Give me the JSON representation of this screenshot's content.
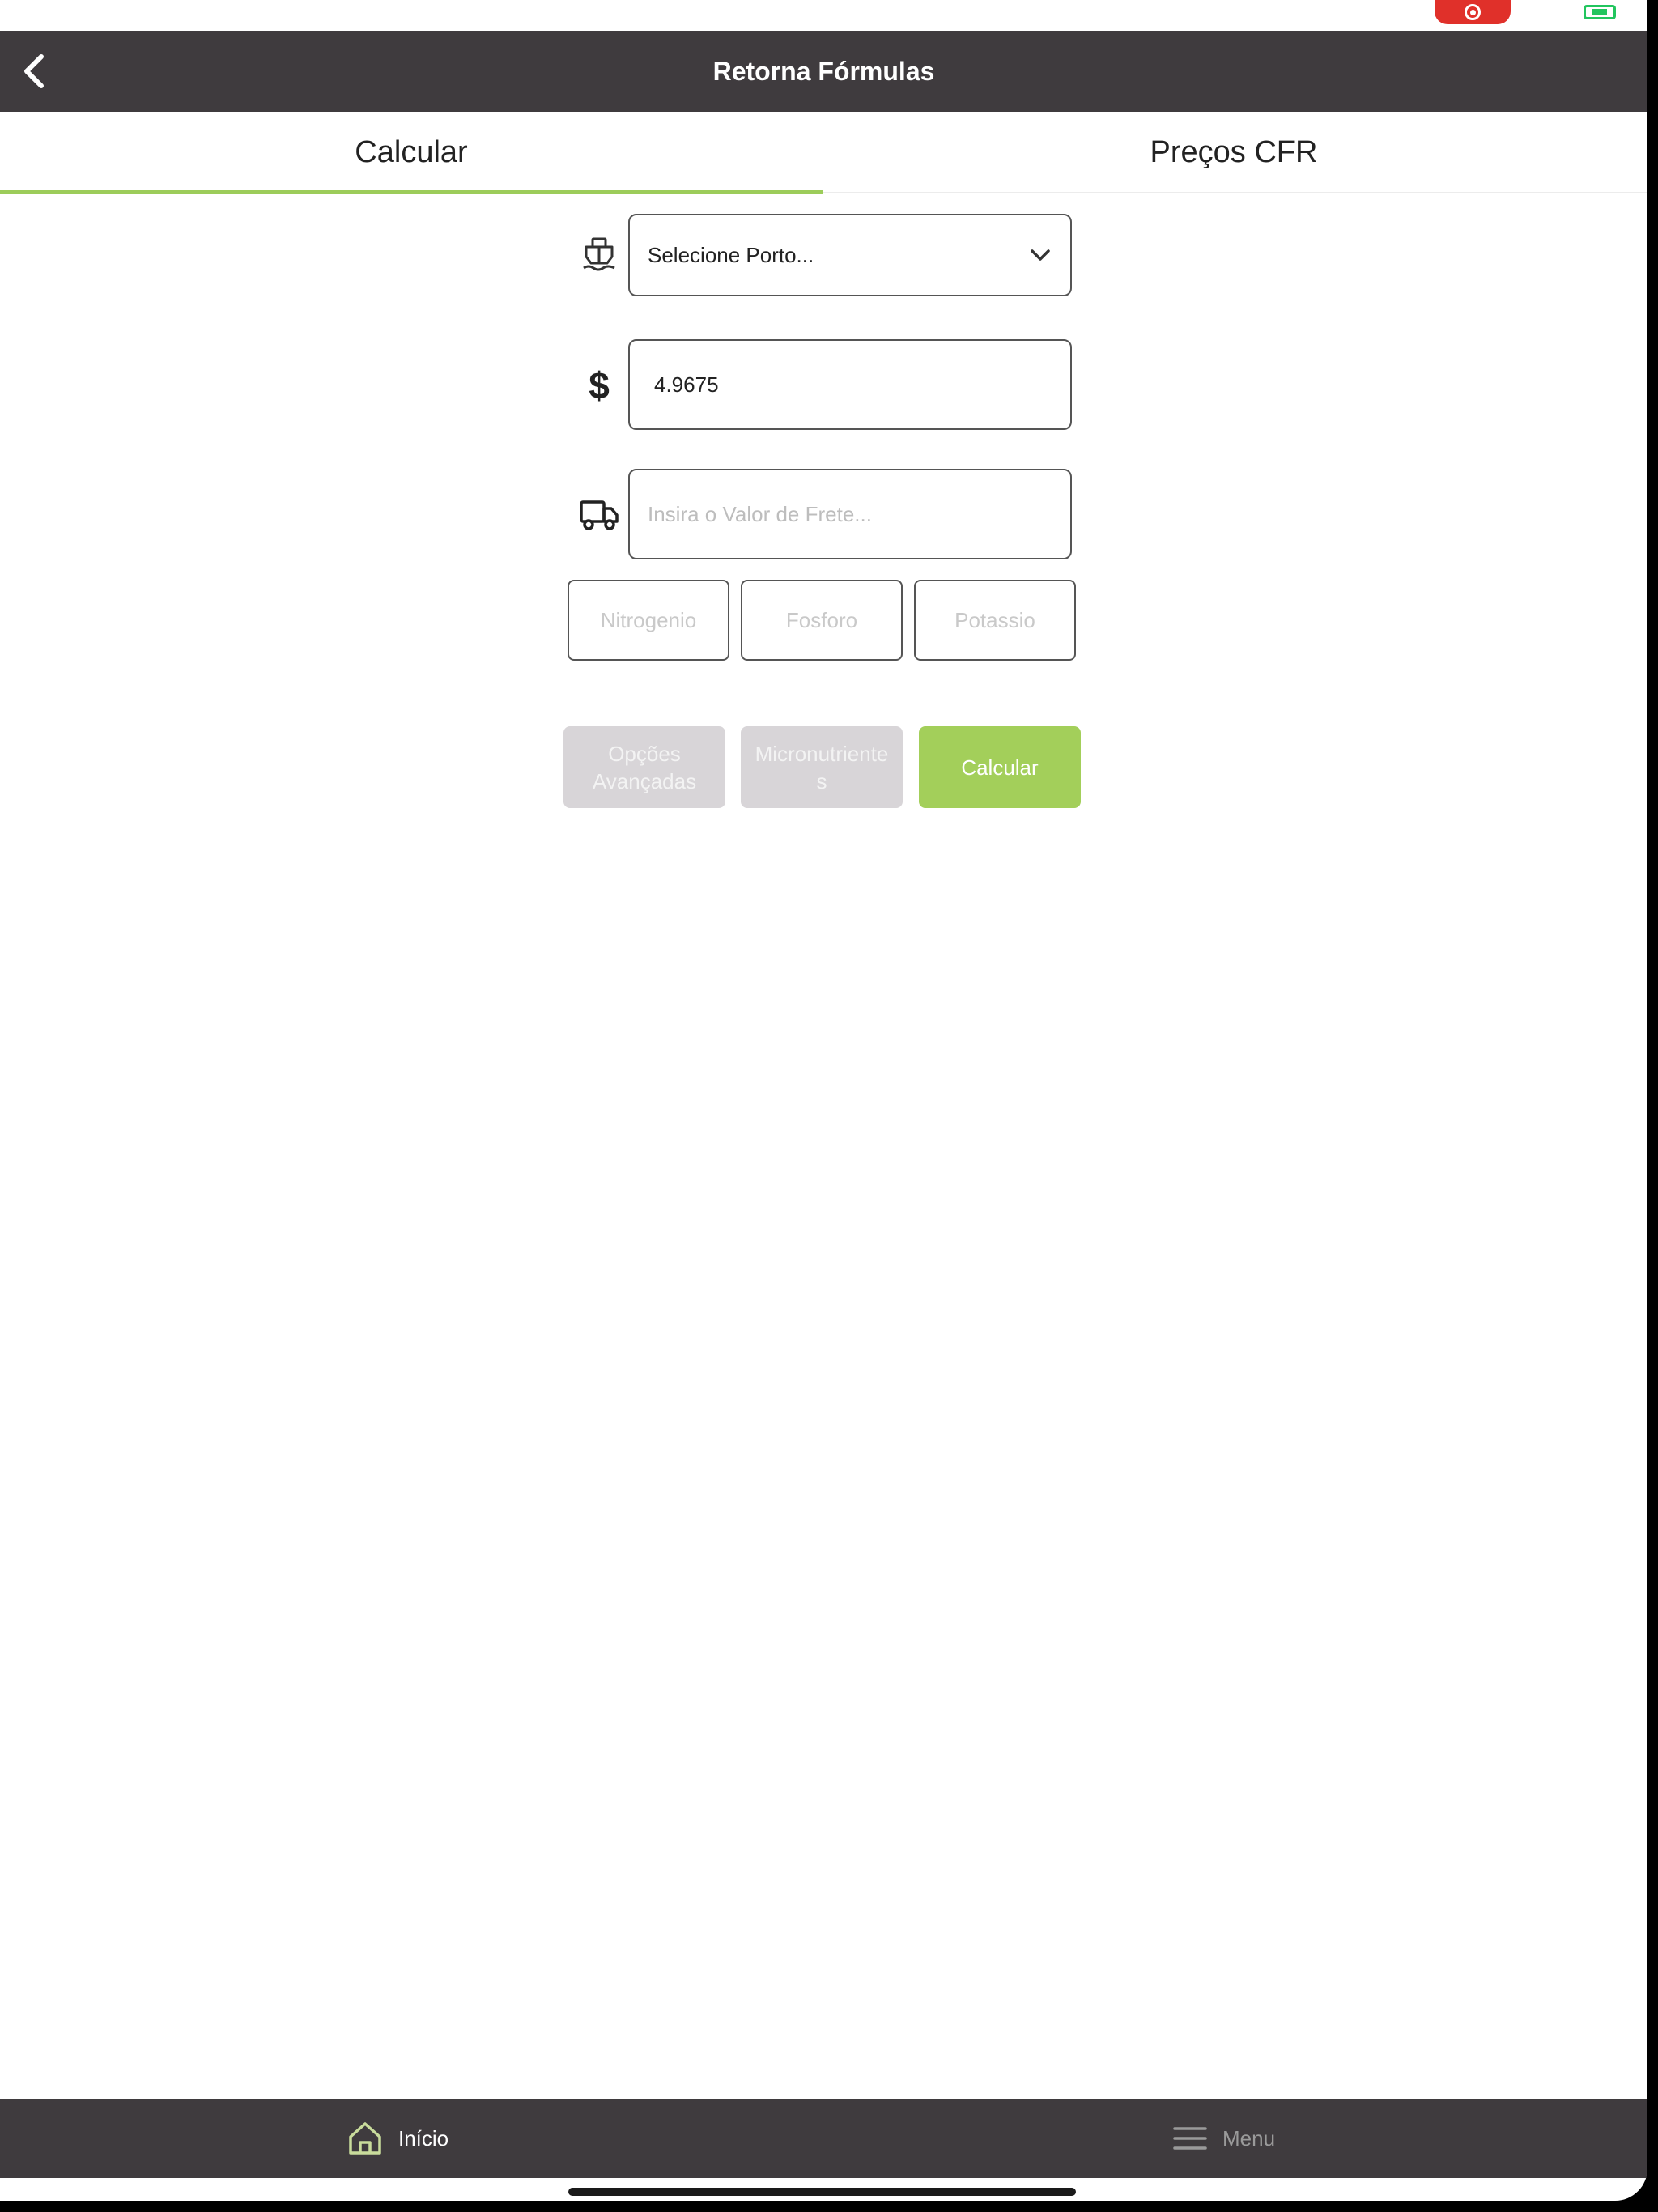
{
  "header": {
    "title": "Retorna Fórmulas"
  },
  "tabs": [
    {
      "label": "Calcular",
      "active": true
    },
    {
      "label": "Preços CFR",
      "active": false
    }
  ],
  "form": {
    "port_select": {
      "value": "Selecione Porto..."
    },
    "dollar_input": {
      "value": "4.9675"
    },
    "freight_input": {
      "placeholder": "Insira o Valor de Frete..."
    },
    "npk": {
      "nitrogen_placeholder": "Nitrogenio",
      "phosphorus_placeholder": "Fosforo",
      "potassium_placeholder": "Potassio"
    }
  },
  "buttons": {
    "advanced_line1": "Opções",
    "advanced_line2": "Avançadas",
    "micro_line1": "Micronutriente",
    "micro_line2": "s",
    "calculate": "Calcular"
  },
  "bottom_nav": {
    "home_label": "Início",
    "menu_label": "Menu"
  },
  "colors": {
    "header_bg": "#3f3b3e",
    "accent_green": "#a3cf5a",
    "disabled_grey": "#d8d5d8",
    "recording_red": "#e0302a",
    "battery_green": "#22c55e"
  }
}
